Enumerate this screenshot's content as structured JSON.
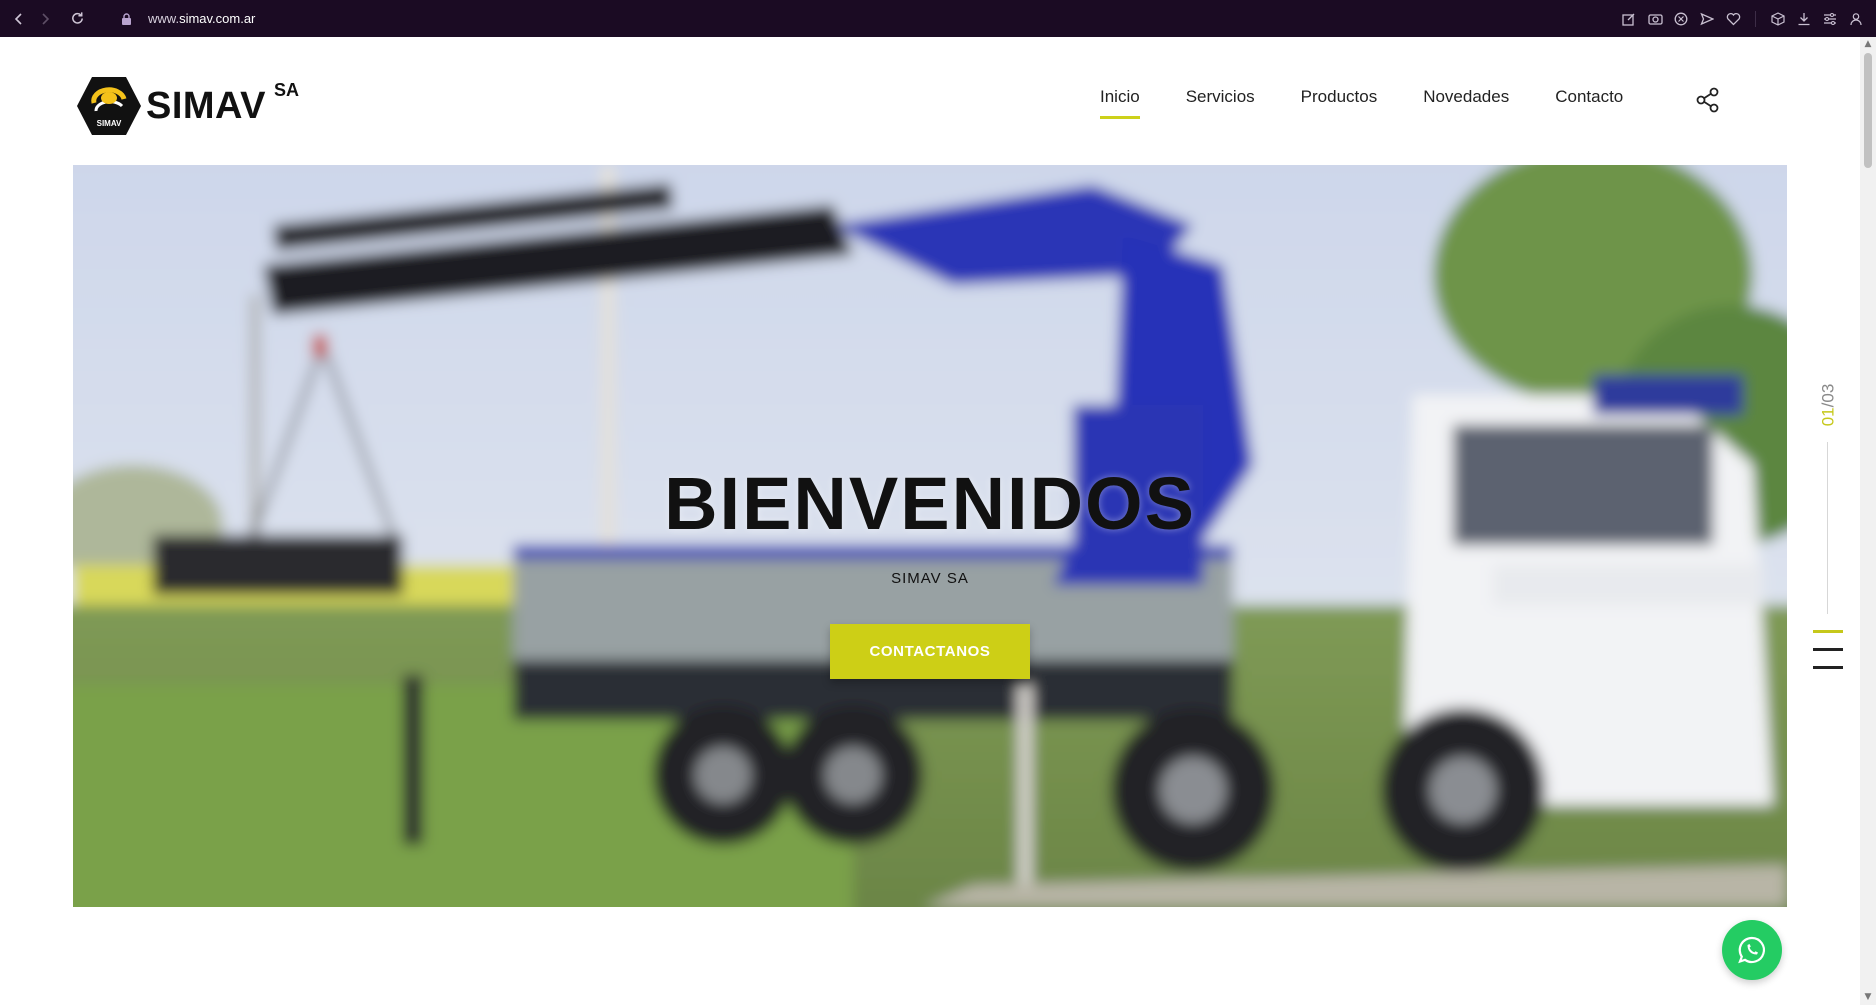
{
  "browser": {
    "url_prefix": "www.",
    "url_host": "simav.com.ar",
    "nav": {
      "back_icon": "back-arrow-icon",
      "forward_icon": "forward-arrow-icon",
      "reload_icon": "reload-icon"
    }
  },
  "header": {
    "logo_text": "SIMAV",
    "logo_suffix": "SA",
    "logo_badge_text": "SIMAV",
    "nav": [
      {
        "label": "Inicio",
        "active": true
      },
      {
        "label": "Servicios",
        "active": false
      },
      {
        "label": "Productos",
        "active": false
      },
      {
        "label": "Novedades",
        "active": false
      },
      {
        "label": "Contacto",
        "active": false
      }
    ],
    "share_icon": "share-icon"
  },
  "hero": {
    "title": "BIENVENIDOS",
    "subtitle": "SIMAV SA",
    "cta_label": "CONTACTANOS"
  },
  "slider": {
    "current": "01",
    "separator": "/",
    "total": "03"
  },
  "colors": {
    "accent": "#cdd11a",
    "browser_bar": "#1b0b23",
    "whatsapp": "#24cc63"
  },
  "floating": {
    "whatsapp_icon": "whatsapp-icon"
  }
}
